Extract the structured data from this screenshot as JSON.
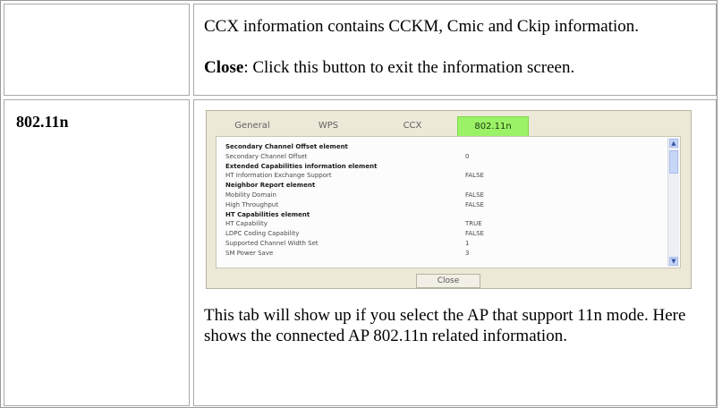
{
  "row1": {
    "line1": "CCX information contains CCKM, Cmic and Ckip information.",
    "close_label": "Close",
    "close_desc": ": Click this button to exit the information screen."
  },
  "row2": {
    "heading": "802.11n",
    "description": "This tab will show up if you select the AP that support 11n mode. Here shows the connected AP 802.11n related information."
  },
  "screenshot": {
    "tabs": [
      "General",
      "WPS",
      "CCX",
      "802.11n"
    ],
    "active_tab": "802.11n",
    "active_color": "#9cf266",
    "rows": [
      {
        "k": "Secondary Channel Offset element",
        "v": "",
        "bold": true
      },
      {
        "k": "Secondary Channel Offset",
        "v": "0",
        "bold": false
      },
      {
        "k": "Extended Capabilities information element",
        "v": "",
        "bold": true
      },
      {
        "k": "HT Information Exchange Support",
        "v": "FALSE",
        "bold": false
      },
      {
        "k": "Neighbor Report element",
        "v": "",
        "bold": true
      },
      {
        "k": "Mobility Domain",
        "v": "FALSE",
        "bold": false
      },
      {
        "k": "High Throughput",
        "v": "FALSE",
        "bold": false
      },
      {
        "k": "HT Capabilities element",
        "v": "",
        "bold": true
      },
      {
        "k": "HT Capability",
        "v": "TRUE",
        "bold": false
      },
      {
        "k": "LDPC Coding Capability",
        "v": "FALSE",
        "bold": false
      },
      {
        "k": "Supported Channel Width Set",
        "v": "1",
        "bold": false
      },
      {
        "k": "SM Power Save",
        "v": "3",
        "bold": false
      }
    ],
    "close_button": "Close"
  }
}
